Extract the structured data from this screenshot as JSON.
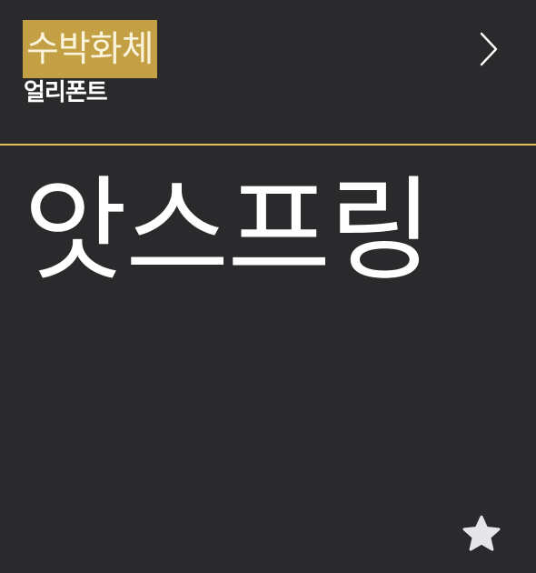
{
  "font_card": {
    "font_name": "수박화체",
    "foundry": "얼리폰트",
    "preview_text": "앗스프링",
    "next_icon": "chevron-right-icon",
    "favorite_icon": "star-icon"
  },
  "colors": {
    "background": "#2a2a2c",
    "name_highlight": "#c2a043",
    "divider": "#e3c25d",
    "text": "#ffffff",
    "star": "#e6e6ea"
  }
}
